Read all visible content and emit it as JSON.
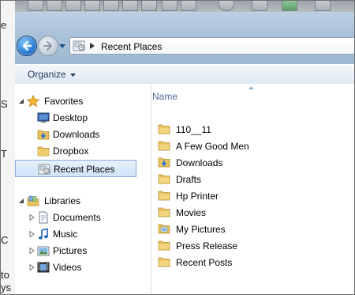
{
  "background_window": {
    "lines": [
      "e",
      "S",
      "T",
      "C",
      "to",
      "ys"
    ]
  },
  "address_bar": {
    "separator_icon": "chevron-right-icon",
    "location": "Recent Places"
  },
  "toolbar": {
    "organize_label": "Organize"
  },
  "nav_pane": {
    "favorites": {
      "label": "Favorites",
      "items": [
        {
          "label": "Desktop",
          "icon": "desktop-icon"
        },
        {
          "label": "Downloads",
          "icon": "downloads-folder-icon"
        },
        {
          "label": "Dropbox",
          "icon": "dropbox-folder-icon"
        },
        {
          "label": "Recent Places",
          "icon": "recent-places-icon",
          "selected": true
        }
      ]
    },
    "libraries": {
      "label": "Libraries",
      "items": [
        {
          "label": "Documents",
          "icon": "documents-icon"
        },
        {
          "label": "Music",
          "icon": "music-icon"
        },
        {
          "label": "Pictures",
          "icon": "pictures-icon"
        },
        {
          "label": "Videos",
          "icon": "videos-icon"
        }
      ]
    }
  },
  "content": {
    "column_header": "Name",
    "items": [
      {
        "label": "110__11",
        "icon": "folder-icon"
      },
      {
        "label": "A Few Good Men",
        "icon": "folder-icon"
      },
      {
        "label": "Downloads",
        "icon": "downloads-folder-icon"
      },
      {
        "label": "Drafts",
        "icon": "folder-icon"
      },
      {
        "label": "Hp Printer",
        "icon": "folder-icon"
      },
      {
        "label": "Movies",
        "icon": "folder-icon"
      },
      {
        "label": "My Pictures",
        "icon": "pictures-folder-icon"
      },
      {
        "label": "Press Release",
        "icon": "folder-icon"
      },
      {
        "label": "Recent Posts",
        "icon": "folder-icon"
      }
    ]
  },
  "colors": {
    "folder": "#e8c25c",
    "selection": "#cfe3f8",
    "header_text": "#4b6c92",
    "chrome": "#a9c2d9"
  }
}
